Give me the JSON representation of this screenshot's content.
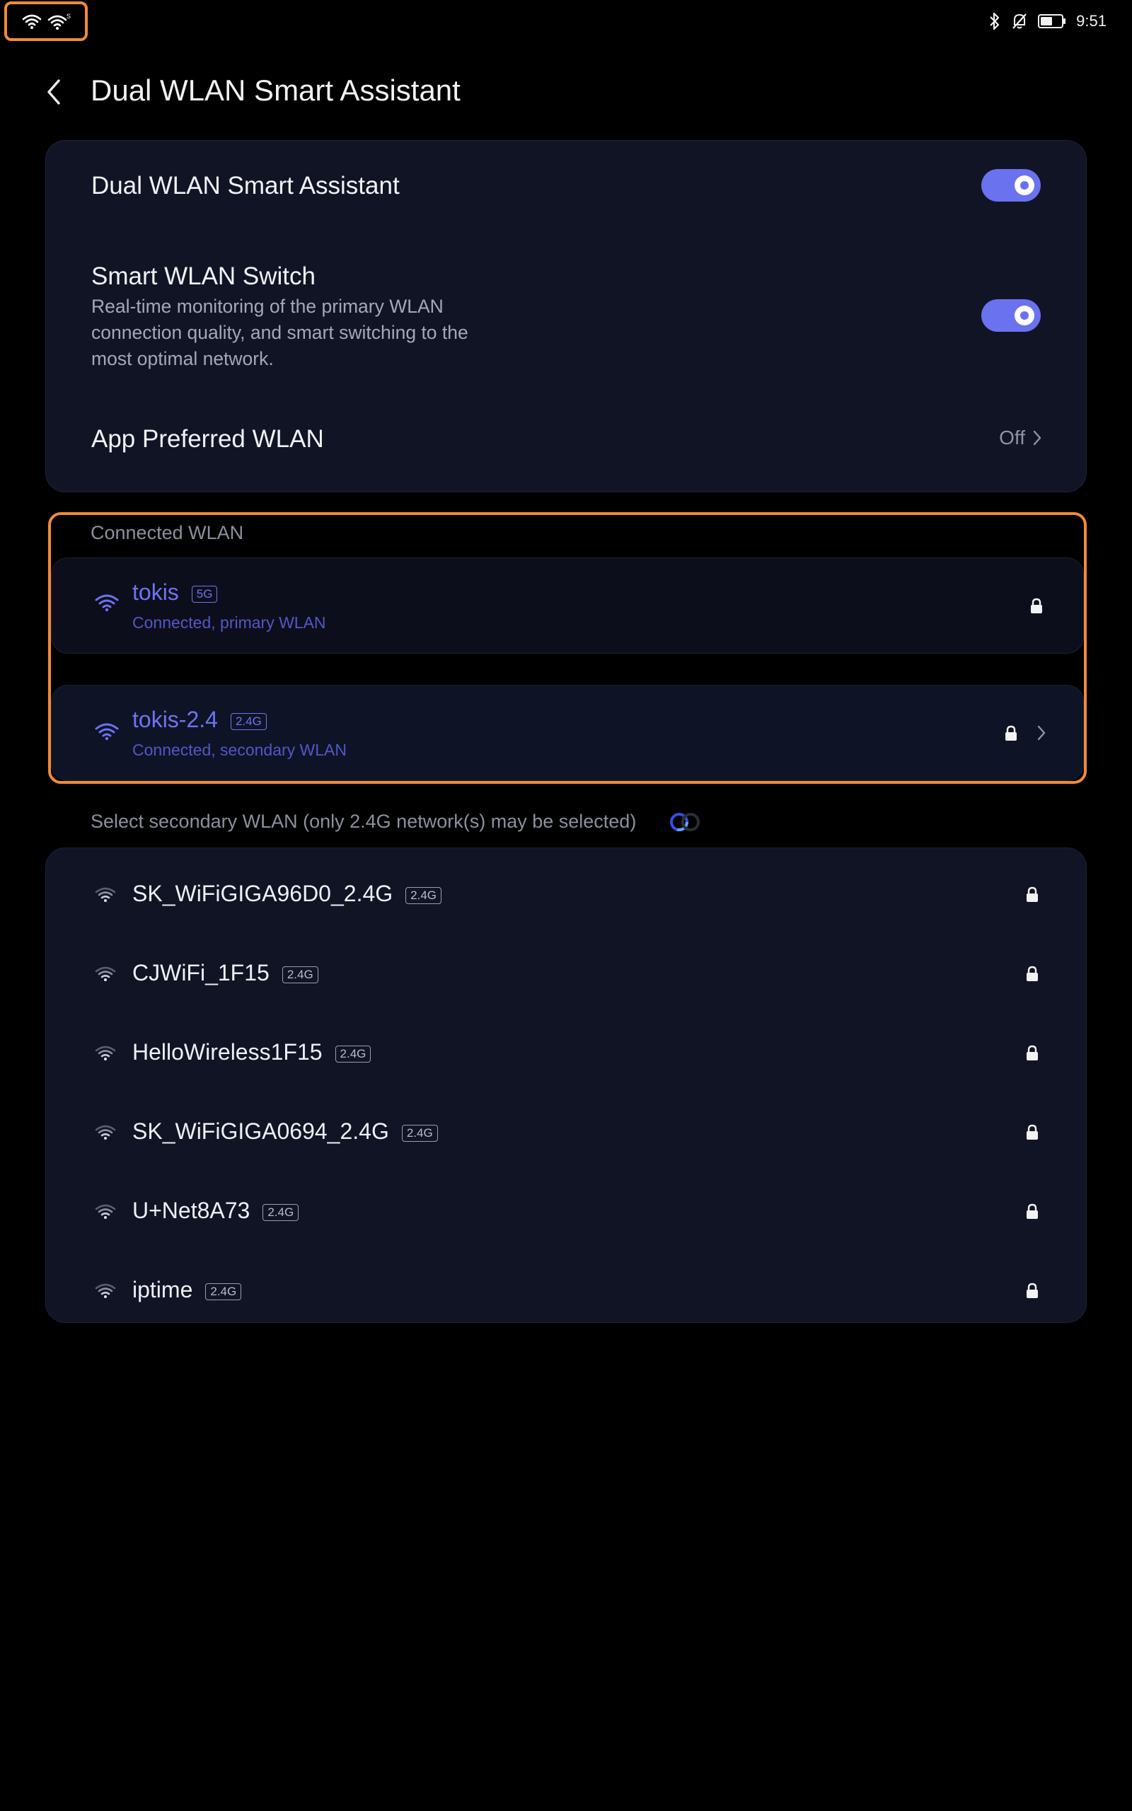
{
  "status_bar": {
    "time": "9:51"
  },
  "header": {
    "title": "Dual WLAN Smart Assistant"
  },
  "settings": {
    "dual_assistant_label": "Dual WLAN Smart Assistant",
    "smart_switch_label": "Smart WLAN Switch",
    "smart_switch_desc": "Real-time monitoring of the primary WLAN connection quality, and smart switching to the most optimal network.",
    "app_preferred_label": "App Preferred WLAN",
    "app_preferred_value": "Off"
  },
  "connected": {
    "section_label": "Connected WLAN",
    "primary": {
      "name": "tokis",
      "band": "5G",
      "status": "Connected, primary WLAN"
    },
    "secondary": {
      "name": "tokis-2.4",
      "band": "2.4G",
      "status": "Connected, secondary WLAN"
    }
  },
  "chooser_label": "Select secondary WLAN (only 2.4G network(s) may be selected)",
  "networks": [
    {
      "name": "SK_WiFiGIGA96D0_2.4G",
      "band": "2.4G"
    },
    {
      "name": "CJWiFi_1F15",
      "band": "2.4G"
    },
    {
      "name": "HelloWireless1F15",
      "band": "2.4G"
    },
    {
      "name": "SK_WiFiGIGA0694_2.4G",
      "band": "2.4G"
    },
    {
      "name": "U+Net8A73",
      "band": "2.4G"
    },
    {
      "name": "iptime",
      "band": "2.4G"
    }
  ],
  "colors": {
    "accent": "#6b72ef",
    "highlight": "#f08a3a",
    "card": "#101425"
  }
}
